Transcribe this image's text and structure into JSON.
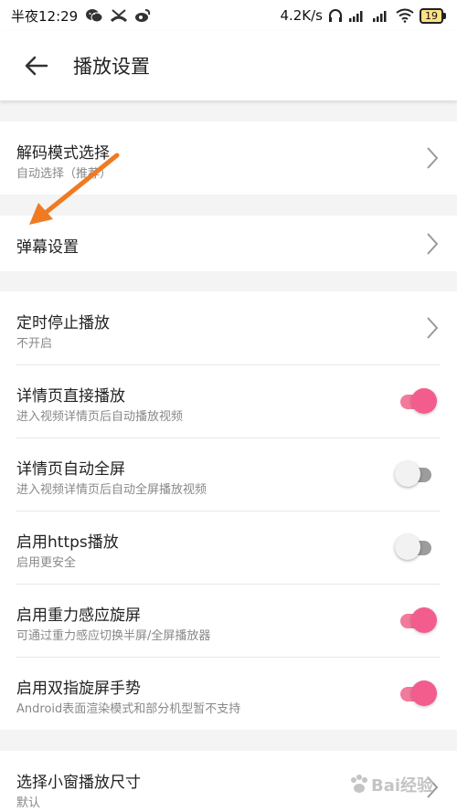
{
  "status_bar": {
    "time": "半夜12:29",
    "network_speed": "4.2K/s",
    "battery": "19",
    "icons": [
      "wechat-icon",
      "missed-call-icon",
      "weibo-icon",
      "headphone-icon",
      "signal-icon",
      "signal-icon",
      "wifi-icon",
      "battery-icon"
    ]
  },
  "header": {
    "title": "播放设置",
    "back_icon": "arrow-left-icon"
  },
  "groups": [
    {
      "rows": [
        {
          "title": "解码模式选择",
          "subtitle": "自动选择（推荐）",
          "control": "chevron"
        }
      ]
    },
    {
      "rows": [
        {
          "title": "弹幕设置",
          "control": "chevron"
        }
      ]
    },
    {
      "rows": [
        {
          "title": "定时停止播放",
          "subtitle": "不开启",
          "control": "chevron"
        },
        {
          "title": "详情页直接播放",
          "subtitle": "进入视频详情页后自动播放视频",
          "control": "toggle",
          "checked": true
        },
        {
          "title": "详情页自动全屏",
          "subtitle": "进入视频详情页后自动全屏播放视频",
          "control": "toggle",
          "checked": false
        },
        {
          "title": "启用https播放",
          "subtitle": "启用更安全",
          "control": "toggle",
          "checked": false
        },
        {
          "title": "启用重力感应旋屏",
          "subtitle": "可通过重力感应切换半屏/全屏播放器",
          "control": "toggle",
          "checked": true
        },
        {
          "title": "启用双指旋屏手势",
          "subtitle": "Android表面渲染模式和部分机型暂不支持",
          "control": "toggle",
          "checked": true
        }
      ]
    },
    {
      "rows": [
        {
          "title": "选择小窗播放尺寸",
          "subtitle": "默认",
          "control": "chevron"
        }
      ]
    }
  ],
  "colors": {
    "toggle_on_knob": "#f25d8e",
    "toggle_on_track": "#f27a9b",
    "toggle_off_track": "#9c9c9c",
    "annotation_arrow": "#f07a22",
    "background": "#f4f4f4"
  },
  "watermark": {
    "text": "Bai经验"
  }
}
